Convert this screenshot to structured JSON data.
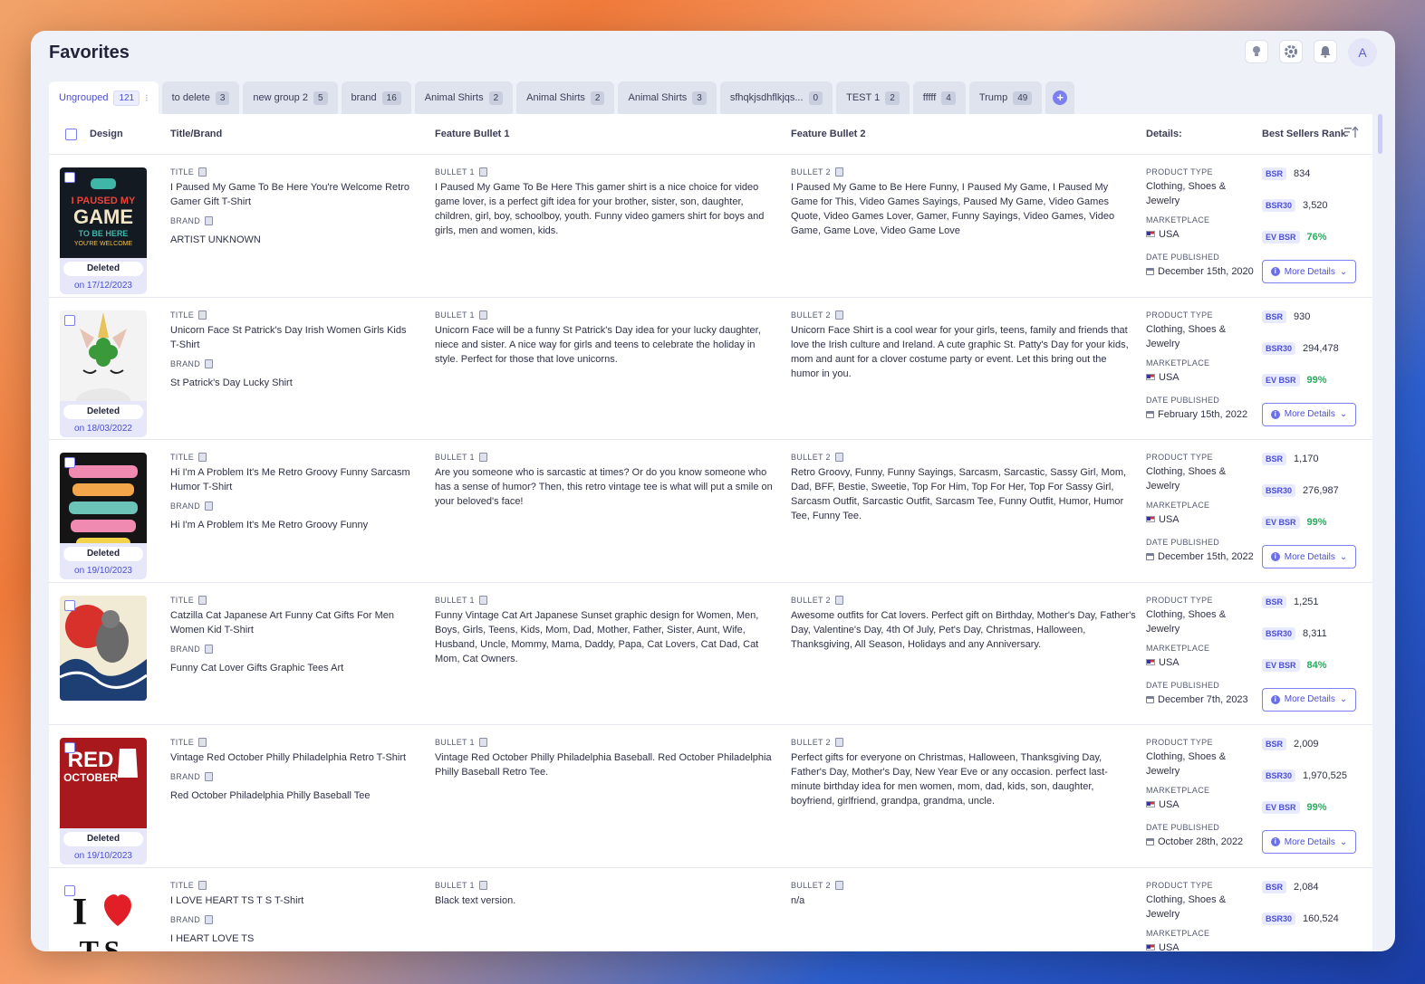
{
  "page": {
    "title": "Favorites",
    "avatar_initial": "A"
  },
  "tabs": [
    {
      "label": "Ungrouped",
      "count": "121"
    },
    {
      "label": "to delete",
      "count": "3"
    },
    {
      "label": "new group 2",
      "count": "5"
    },
    {
      "label": "brand",
      "count": "16"
    },
    {
      "label": "Animal Shirts",
      "count": "2"
    },
    {
      "label": "Animal Shirts",
      "count": "2"
    },
    {
      "label": "Animal Shirts",
      "count": "3"
    },
    {
      "label": "sfhqkjsdhflkjqs...",
      "count": "0"
    },
    {
      "label": "TEST 1",
      "count": "2"
    },
    {
      "label": "fffff",
      "count": "4"
    },
    {
      "label": "Trump",
      "count": "49"
    }
  ],
  "columns": {
    "design": "Design",
    "title_brand": "Title/Brand",
    "bullet1": "Feature Bullet 1",
    "bullet2": "Feature Bullet 2",
    "details": "Details:",
    "bsr": "Best Sellers Rank"
  },
  "labels": {
    "title": "TITLE",
    "brand": "BRAND",
    "bullet1": "BULLET 1",
    "bullet2": "BULLET 2",
    "product_type": "PRODUCT TYPE",
    "marketplace": "MARKETPLACE",
    "date_published": "DATE PUBLISHED",
    "bsr": "BSR",
    "bsr30": "BSR30",
    "ev_bsr": "EV BSR",
    "more_details": "More Details",
    "deleted": "Deleted"
  },
  "rows": [
    {
      "title": "I Paused My Game To Be Here You're Welcome Retro Gamer Gift T-Shirt",
      "brand": "ARTIST UNKNOWN",
      "bullet1": "I Paused My Game To Be Here This gamer shirt is a nice choice for video game lover, is a perfect gift idea for your brother, sister, son, daughter, children, girl, boy, schoolboy, youth. Funny video gamers shirt for boys and girls, men and women, kids.",
      "bullet2": "I Paused My Game to Be Here Funny, I Paused My Game, I Paused My Game for This, Video Games Sayings, Paused My Game, Video Games Quote, Video Games Lover, Gamer, Funny Sayings, Video Games, Video Game, Game Love, Video Game Love",
      "product_type": "Clothing, Shoes & Jewelry",
      "marketplace": "USA",
      "date": "December 15th, 2020",
      "bsr": "834",
      "bsr30": "3,520",
      "ev_bsr": "76%",
      "deleted_on": "on 17/12/2023"
    },
    {
      "title": "Unicorn Face St Patrick's Day Irish Women Girls Kids T-Shirt",
      "brand": "St Patrick's Day Lucky Shirt",
      "bullet1": "Unicorn Face will be a funny St Patrick's Day idea for your lucky daughter, niece and sister. A nice way for girls and teens to celebrate the holiday in style. Perfect for those that love unicorns.",
      "bullet2": "Unicorn Face Shirt is a cool wear for your girls, teens, family and friends that love the Irish culture and Ireland. A cute graphic St. Patty's Day for your kids, mom and aunt for a clover costume party or event. Let this bring out the humor in you.",
      "product_type": "Clothing, Shoes & Jewelry",
      "marketplace": "USA",
      "date": "February 15th, 2022",
      "bsr": "930",
      "bsr30": "294,478",
      "ev_bsr": "99%",
      "deleted_on": "on 18/03/2022"
    },
    {
      "title": "Hi I'm A Problem It's Me Retro Groovy Funny Sarcasm Humor T-Shirt",
      "brand": "Hi I'm A Problem It's Me Retro Groovy Funny",
      "bullet1": "Are you someone who is sarcastic at times? Or do you know someone who has a sense of humor? Then, this retro vintage tee is what will put a smile on your beloved's face!",
      "bullet2": "Retro Groovy, Funny, Funny Sayings, Sarcasm, Sarcastic, Sassy Girl, Mom, Dad, BFF, Bestie, Sweetie, Top For Him, Top For Her, Top For Sassy Girl, Sarcasm Outfit, Sarcastic Outfit, Sarcasm Tee, Funny Outfit, Humor, Humor Tee, Funny Tee.",
      "product_type": "Clothing, Shoes & Jewelry",
      "marketplace": "USA",
      "date": "December 15th, 2022",
      "bsr": "1,170",
      "bsr30": "276,987",
      "ev_bsr": "99%",
      "deleted_on": "on 19/10/2023"
    },
    {
      "title": "Catzilla Cat Japanese Art Funny Cat Gifts For Men Women Kid T-Shirt",
      "brand": "Funny Cat Lover Gifts Graphic Tees Art",
      "bullet1": "Funny Vintage Cat Art Japanese Sunset graphic design for Women, Men, Boys, Girls, Teens, Kids, Mom, Dad, Mother, Father, Sister, Aunt, Wife, Husband, Uncle, Mommy, Mama, Daddy, Papa, Cat Lovers, Cat Dad, Cat Mom, Cat Owners.",
      "bullet2": "Awesome outfits for Cat lovers. Perfect gift on Birthday, Mother's Day, Father's Day, Valentine's Day, 4th Of July, Pet's Day, Christmas, Halloween, Thanksgiving, All Season, Holidays and any Anniversary.",
      "product_type": "Clothing, Shoes & Jewelry",
      "marketplace": "USA",
      "date": "December 7th, 2023",
      "bsr": "1,251",
      "bsr30": "8,311",
      "ev_bsr": "84%",
      "deleted_on": ""
    },
    {
      "title": "Vintage Red October Philly Philadelphia Retro T-Shirt",
      "brand": "Red October Philadelphia Philly Baseball Tee",
      "bullet1": "Vintage Red October Philly Philadelphia Baseball. Red October Philadelphia Philly Baseball Retro Tee.",
      "bullet2": "Perfect gifts for everyone on Christmas, Halloween, Thanksgiving Day, Father's Day, Mother's Day, New Year Eve or any occasion. perfect last-minute birthday idea for men women, mom, dad, kids, son, daughter, boyfriend, girlfriend, grandpa, grandma, uncle.",
      "product_type": "Clothing, Shoes & Jewelry",
      "marketplace": "USA",
      "date": "October 28th, 2022",
      "bsr": "2,009",
      "bsr30": "1,970,525",
      "ev_bsr": "99%",
      "deleted_on": "on 19/10/2023"
    },
    {
      "title": "I LOVE HEART TS T S T-Shirt",
      "brand": "I HEART LOVE TS",
      "bullet1": "Black text version.",
      "bullet2": "n/a",
      "product_type": "Clothing, Shoes & Jewelry",
      "marketplace": "USA",
      "date": "",
      "bsr": "2,084",
      "bsr30": "160,524",
      "ev_bsr": "",
      "deleted_on": ""
    }
  ],
  "thumb_art": {
    "r0": {
      "line1": "I PAUSED MY",
      "line2": "GAME",
      "line3": "TO BE HERE",
      "line4": "YOU'RE WELCOME"
    },
    "r4": {
      "line1": "RED",
      "line2": "OCTOBER"
    },
    "r5": {
      "line1": "I",
      "line2": "T.S."
    }
  },
  "colors": {
    "accent": "#4b4fd1",
    "ev_green": "#1fb15a"
  }
}
